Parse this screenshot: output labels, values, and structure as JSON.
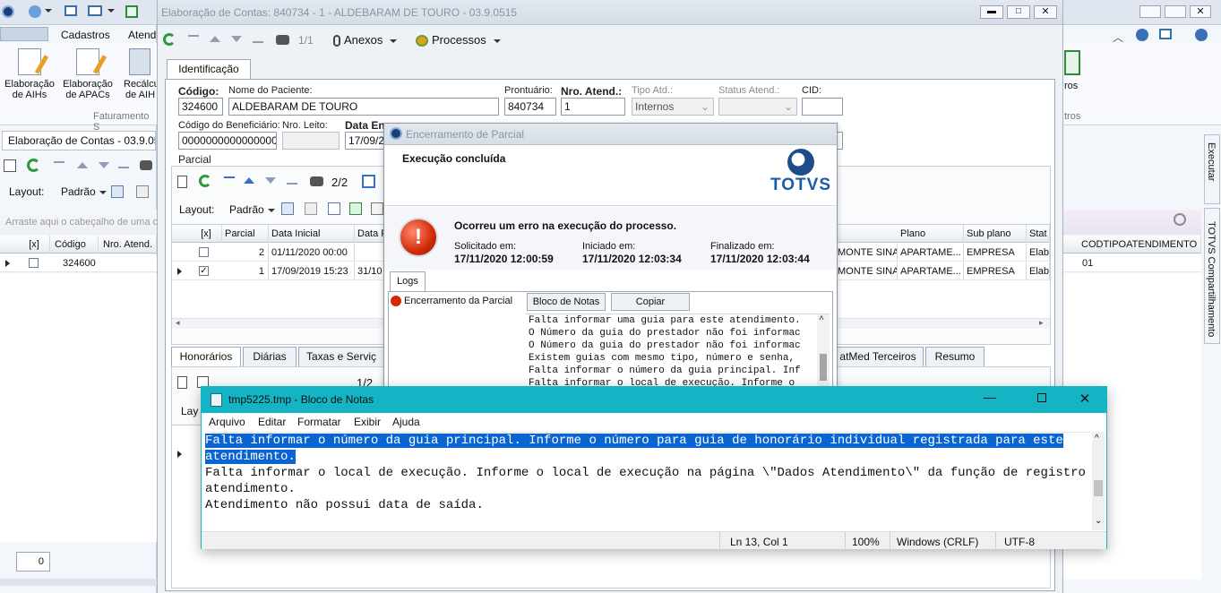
{
  "bg_app": {
    "ribbon_tabs": [
      "Cadastros",
      "Atend"
    ],
    "ribbon_buttons": [
      {
        "label1": "Elaboração",
        "label2": "de AIHs"
      },
      {
        "label1": "Elaboração",
        "label2": "de APACs"
      },
      {
        "label1": "Recálcu",
        "label2": "de AIH"
      }
    ],
    "ribbon_group": "Faturamento S",
    "doc_tab": "Elaboração de Contas - 03.9.051",
    "layout_label": "Layout:",
    "layout_value": "Padrão",
    "drag_hint": "Arraste aqui o cabeçalho de uma c",
    "grid_headers": [
      "[x]",
      "Código",
      "Nro. Atend."
    ],
    "grid_row": {
      "codigo": "324600"
    },
    "page_input": "0",
    "right_ribbon": {
      "label1": "ros",
      "group": "tros"
    },
    "side_tabs": [
      "Executar",
      "TOTVS Compartilhamento"
    ]
  },
  "main_window": {
    "title": "Elaboração de Contas: 840734 - 1 - ALDEBARAM DE TOURO - 03.9.0515",
    "record_nav": "1/1",
    "anexos": "Anexos",
    "processos": "Processos",
    "tab_identificacao": "Identificação",
    "fields": {
      "codigo_label": "Código:",
      "codigo": "324600",
      "paciente_label": "Nome do Paciente:",
      "paciente": "ALDEBARAM DE TOURO",
      "prontuario_label": "Prontuário:",
      "prontuario": "840734",
      "nro_atend_label": "Nro. Atend.:",
      "nro_atend": "1",
      "tipo_atd_label": "Tipo Atd.:",
      "tipo_atd": "Internos",
      "status_label": "Status Atend.:",
      "cid_label": "CID:",
      "beneficiario_label": "Código do Beneficiário:",
      "beneficiario": "0000000000000000",
      "leito_label": "Nro. Leito:",
      "data_label": "Data En",
      "data": "17/09/2"
    },
    "parcial": {
      "group": "Parcial",
      "nav": "2/2",
      "layout_label": "Layout:",
      "layout_value": "Padrão",
      "headers": [
        "[x]",
        "Parcial",
        "Data Inicial",
        "Data F"
      ],
      "right_headers": [
        "Plano",
        "Sub plano",
        "Stat"
      ],
      "rows": [
        {
          "checked": false,
          "parcial": "2",
          "data_inicial": "01/11/2020 00:00",
          "monte": "MONTE SINAI",
          "plano": "APARTAME...",
          "sub": "EMPRESA",
          "stat": "Elab"
        },
        {
          "checked": true,
          "parcial": "1",
          "data_inicial": "17/09/2019 15:23",
          "data_f": "31/10",
          "monte": "MONTE SINAI",
          "plano": "APARTAME...",
          "sub": "EMPRESA",
          "stat": "Elab"
        }
      ]
    },
    "lower_tabs": [
      "Honorários",
      "Diárias",
      "Taxas e Serviç",
      "atMed Terceiros",
      "Resumo"
    ],
    "lower_nav": "1/2",
    "lower_layout": "Lay"
  },
  "bg_grid_right": {
    "header": "CODTIPOATENDIMENTO",
    "value": "01"
  },
  "dialog": {
    "title": "Encerramento de Parcial",
    "heading": "Execução concluída",
    "brand": "TOTVS",
    "error_msg": "Ocorreu um erro na execução do processo.",
    "solicitado_label": "Solicitado em:",
    "solicitado": "17/11/2020 12:00:59",
    "iniciado_label": "Iniciado em:",
    "iniciado": "17/11/2020 12:03:34",
    "finalizado_label": "Finalizado em:",
    "finalizado": "17/11/2020 12:03:44",
    "logs_tab": "Logs",
    "tree_item": "Encerramento da Parcial",
    "bloco_btn": "Bloco de Notas",
    "copiar_btn": "Copiar",
    "log_lines": [
      "Falta informar uma guia para este atendimento.",
      "O Número da guia do prestador não foi informac",
      "O Número da guia do prestador não foi informac",
      "Existem guias com mesmo tipo, número e senha,",
      "Falta informar o número da guia principal. Inf",
      "Falta informar o local de execução. Informe o"
    ]
  },
  "notepad": {
    "title": "tmp5225.tmp - Bloco de Notas",
    "menu": [
      "Arquivo",
      "Editar",
      "Formatar",
      "Exibir",
      "Ajuda"
    ],
    "lines": [
      {
        "text": "Falta informar o número da guia principal. Informe o número para guia de honorário individual registrada para este",
        "selected": true
      },
      {
        "text": "atendimento.",
        "selected": true
      },
      {
        "text": "Falta informar o local de execução. Informe o local de execução na página \\\"Dados Atendimento\\\" da função de registro de",
        "selected": false
      },
      {
        "text": "atendimento.",
        "selected": false
      },
      {
        "text": "Atendimento não possui data de saída.",
        "selected": false
      }
    ],
    "status": {
      "position": "Ln 13, Col 1",
      "zoom": "100%",
      "eol": "Windows (CRLF)",
      "encoding": "UTF-8"
    },
    "titlebar_color": "#14b4c4",
    "selection_color": "#0a64d2"
  }
}
